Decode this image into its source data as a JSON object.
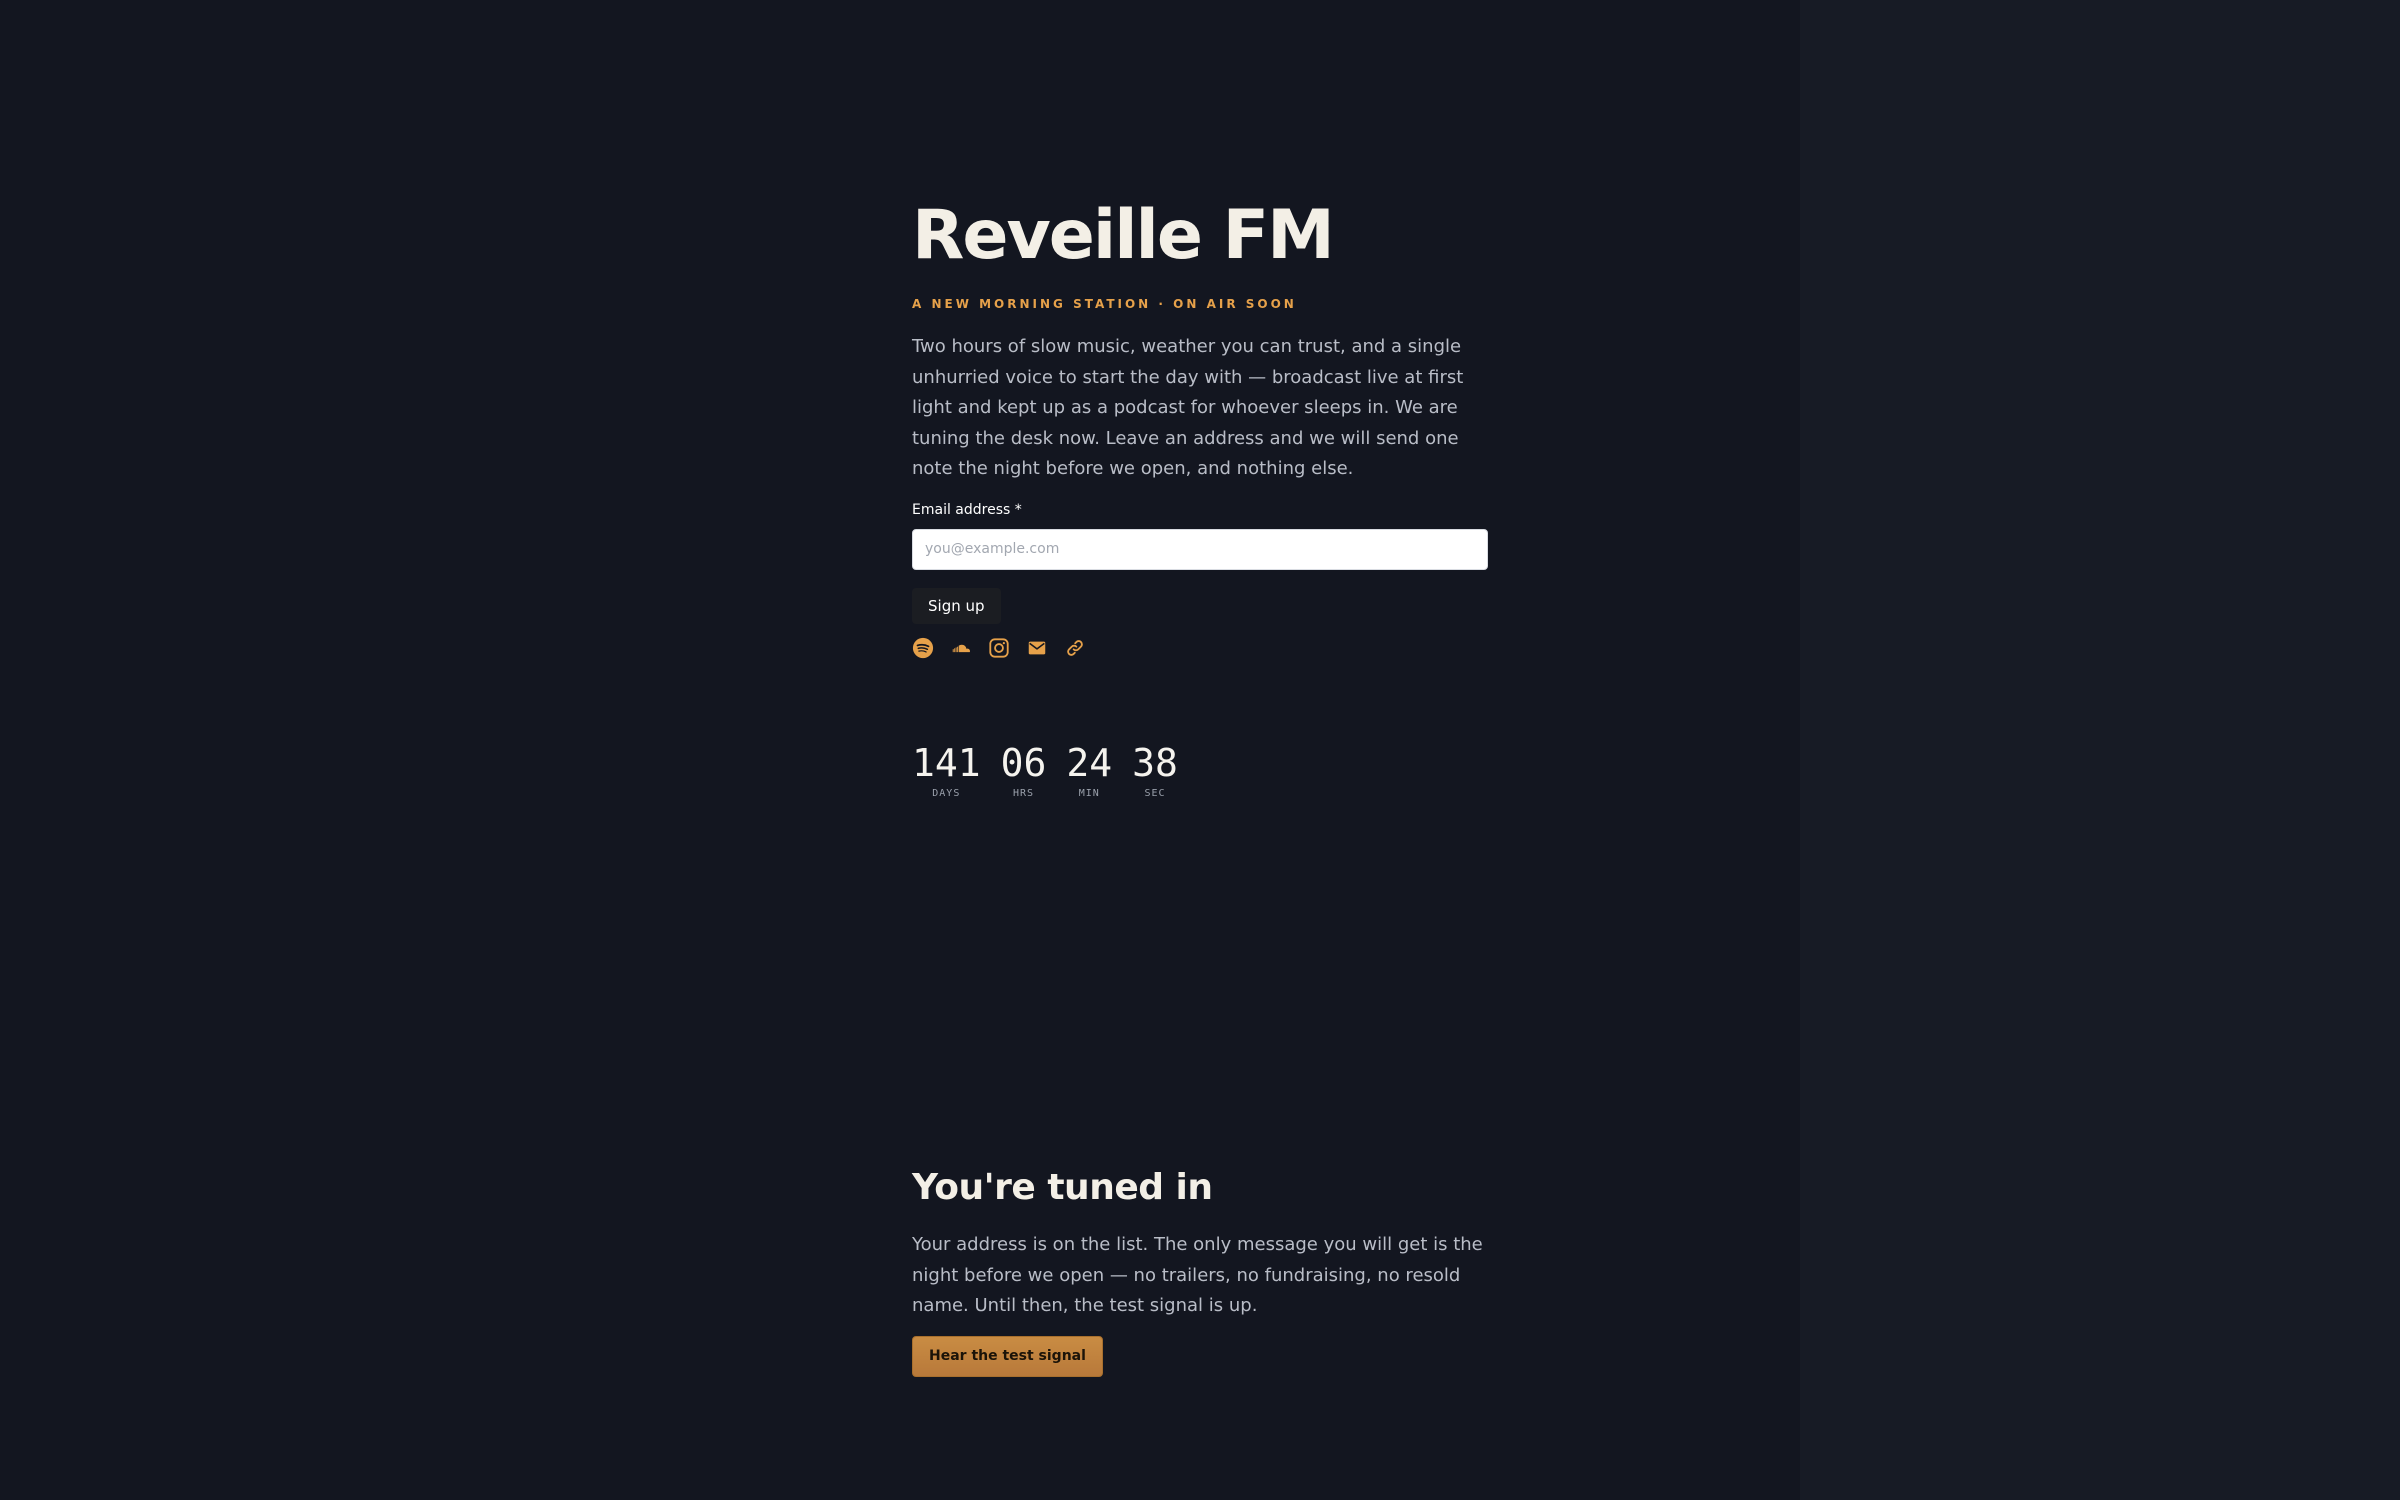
{
  "station": {
    "title": "Reveille FM",
    "tagline": "A NEW MORNING STATION · ON AIR SOON",
    "intro": "Two hours of slow music, weather you can trust, and a single unhurried voice to start the day with — broadcast live at first light and kept up as a podcast for whoever sleeps in. We are tuning the desk now. Leave an address and we will send one note the night before we open, and nothing else."
  },
  "signup_form": {
    "email_label": "Email address *",
    "email_placeholder": "you@example.com",
    "email_value": "",
    "submit_label": "Sign up"
  },
  "social_links": [
    {
      "icon": "spotify-icon"
    },
    {
      "icon": "soundcloud-icon"
    },
    {
      "icon": "instagram-icon"
    },
    {
      "icon": "mail-icon"
    },
    {
      "icon": "link-icon"
    }
  ],
  "countdown": [
    {
      "value": "141",
      "unit": "DAYS"
    },
    {
      "value": "06",
      "unit": "HRS"
    },
    {
      "value": "24",
      "unit": "MIN"
    },
    {
      "value": "38",
      "unit": "SEC"
    }
  ],
  "confirmation": {
    "title": "You're tuned in",
    "text": "Your address is on the list. The only message you will get is the night before we open — no trailers, no fundraising, no resold name. Until then, the test signal is up.",
    "button_label": "Hear the test signal"
  },
  "colors": {
    "background": "#131620",
    "side_panel": "#171b25",
    "accent": "#e6a14a",
    "button_gold": "#c98c43"
  }
}
